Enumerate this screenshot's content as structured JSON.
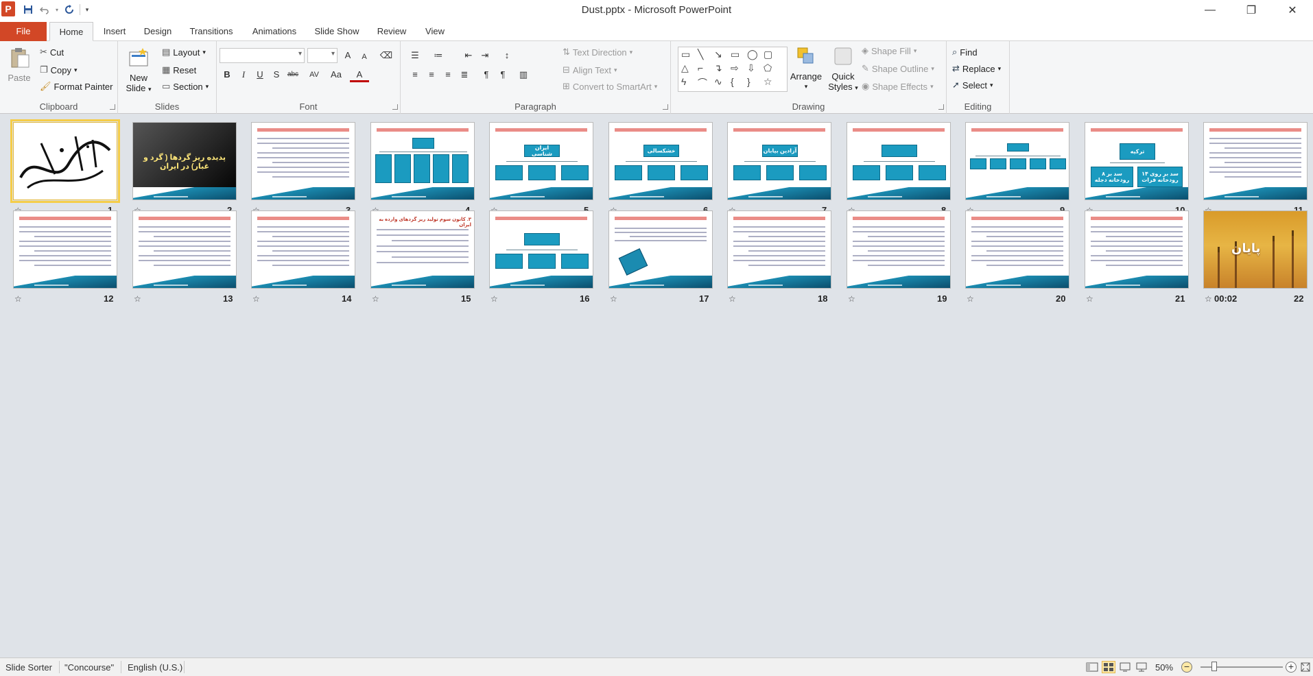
{
  "window": {
    "title": "Dust.pptx - Microsoft PowerPoint",
    "app_logo": "P",
    "controls": {
      "minimize": "—",
      "restore": "❐",
      "close": "✕"
    }
  },
  "qat": {
    "save_icon": "save-icon",
    "undo_icon": "undo-icon",
    "redo_icon": "redo-icon"
  },
  "tabs": [
    {
      "label": "File"
    },
    {
      "label": "Home",
      "active": true
    },
    {
      "label": "Insert"
    },
    {
      "label": "Design"
    },
    {
      "label": "Transitions"
    },
    {
      "label": "Animations"
    },
    {
      "label": "Slide Show"
    },
    {
      "label": "Review"
    },
    {
      "label": "View"
    }
  ],
  "ribbon": {
    "clipboard": {
      "label": "Clipboard",
      "paste": "Paste",
      "cut": "Cut",
      "copy": "Copy",
      "format_painter": "Format Painter"
    },
    "slides": {
      "label": "Slides",
      "new_slide_1": "New",
      "new_slide_2": "Slide",
      "layout": "Layout",
      "reset": "Reset",
      "section": "Section"
    },
    "font": {
      "label": "Font",
      "bold": "B",
      "italic": "I",
      "underline": "U",
      "shadow": "S",
      "strike": "abc",
      "spacing": "AV",
      "case": "Aa",
      "color": "A",
      "grow": "A",
      "shrink": "A"
    },
    "paragraph": {
      "label": "Paragraph",
      "text_direction": "Text Direction",
      "align_text": "Align Text",
      "convert_smartart": "Convert to SmartArt"
    },
    "drawing": {
      "label": "Drawing",
      "arrange": "Arrange",
      "quick_styles_1": "Quick",
      "quick_styles_2": "Styles",
      "shape_fill": "Shape Fill",
      "shape_outline": "Shape Outline",
      "shape_effects": "Shape Effects"
    },
    "editing": {
      "label": "Editing",
      "find": "Find",
      "replace": "Replace",
      "select": "Select"
    }
  },
  "slides": [
    {
      "num": "1",
      "kind": "calligraphy",
      "selected": true
    },
    {
      "num": "2",
      "kind": "dark",
      "title": "پدیده ریز گردها ( گرد و غبار) در ایران"
    },
    {
      "num": "3",
      "kind": "text"
    },
    {
      "num": "4",
      "kind": "org4"
    },
    {
      "num": "5",
      "kind": "org3",
      "node": "ایران شناسی"
    },
    {
      "num": "6",
      "kind": "org3",
      "node": "خشکسالی"
    },
    {
      "num": "7",
      "kind": "org3",
      "node": "آزادین بیابان"
    },
    {
      "num": "8",
      "kind": "org3"
    },
    {
      "num": "9",
      "kind": "org5"
    },
    {
      "num": "10",
      "kind": "org2",
      "node": "ترکیه",
      "left": "۸ سد بر رودخانه دجله",
      "right": "۱۴ سد بر روی رودخانه فرات"
    },
    {
      "num": "11",
      "kind": "text"
    },
    {
      "num": "12",
      "kind": "text"
    },
    {
      "num": "13",
      "kind": "text"
    },
    {
      "num": "14",
      "kind": "text"
    },
    {
      "num": "15",
      "kind": "bigtext",
      "title": "۳. کانون سوم تولید ریز گردهای وارده به ایران"
    },
    {
      "num": "16",
      "kind": "org3"
    },
    {
      "num": "17",
      "kind": "bookslide"
    },
    {
      "num": "18",
      "kind": "text"
    },
    {
      "num": "19",
      "kind": "text"
    },
    {
      "num": "20",
      "kind": "text"
    },
    {
      "num": "21",
      "kind": "text"
    },
    {
      "num": "22",
      "kind": "sand",
      "title": "پایان",
      "time": "00:02"
    }
  ],
  "status": {
    "view": "Slide Sorter",
    "theme": "\"Concourse\"",
    "language": "English (U.S.)",
    "zoom": "50%"
  }
}
